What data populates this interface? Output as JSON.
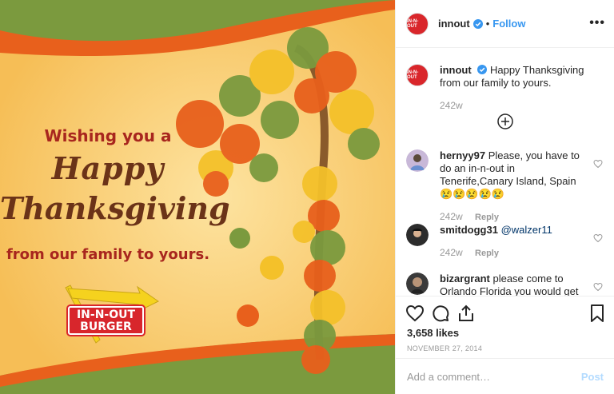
{
  "post_image": {
    "greeting_line1": "Wishing you a",
    "greeting_line2": "Happy",
    "greeting_line3": "Thanksgiving",
    "greeting_line4": "from our family to yours.",
    "logo_line1": "IN-N-OUT",
    "logo_line2": "BURGER",
    "colors": {
      "background": "#f8c766",
      "red": "#a8261e",
      "brown": "#6b3318",
      "green": "#7b9a3e",
      "orange": "#e8601c"
    }
  },
  "header": {
    "avatar_text": "IN-N-OUT",
    "username": "innout",
    "verified_icon": "verified-badge-icon",
    "separator": "•",
    "follow_label": "Follow",
    "more_icon": "more-options-icon",
    "more_label": "•••"
  },
  "caption": {
    "username": "innout",
    "text": "Happy Thanksgiving from our family to yours.",
    "age": "242w"
  },
  "load_more_icon": "plus-circle-icon",
  "comments": [
    {
      "username": "hernyy97",
      "text": "Please, you have to do an in-n-out in Tenerife,Canary Island, Spain 😢😢😢😢😢",
      "age": "242w",
      "reply_label": "Reply"
    },
    {
      "username": "smitdogg31",
      "mention": "@walzer11",
      "age": "242w",
      "reply_label": "Reply"
    },
    {
      "username": "bizargrant",
      "text": "please come to Orlando Florida you would get so"
    }
  ],
  "actions": {
    "like_icon": "heart-icon",
    "comment_icon": "comment-icon",
    "share_icon": "share-icon",
    "save_icon": "bookmark-icon",
    "likes": "3,658 likes",
    "date": "NOVEMBER 27, 2014"
  },
  "add_comment": {
    "placeholder": "Add a comment…",
    "post_label": "Post"
  },
  "colors": {
    "accent": "#3897f0",
    "post_disabled": "#b3dbff",
    "text": "#262626",
    "muted": "#999999"
  }
}
